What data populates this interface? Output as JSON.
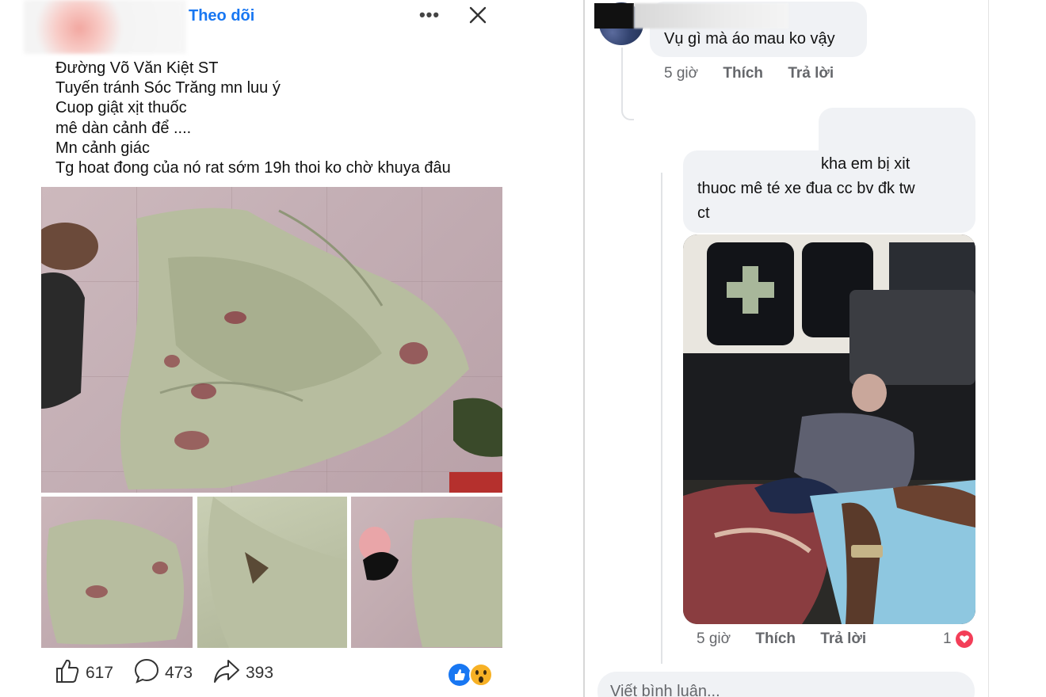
{
  "post": {
    "follow_label": "Theo dõi",
    "more_label": "•••",
    "lines": [
      "Đường Võ Văn Kiệt ST",
      "Tuyến tránh Sóc Trăng mn luu ý",
      "Cuop giật xịt thuốc",
      "mê dàn cảnh để ....",
      "Mn cảnh giác",
      "Tg hoat đong của nó rat sớm 19h thoi ko chờ khuya đâu"
    ],
    "stats": {
      "likes": "617",
      "comments": "473",
      "shares": "393"
    },
    "reaction_icons": [
      "like-icon",
      "wow-icon"
    ]
  },
  "comments": [
    {
      "text": "Vụ gì mà áo mau ko vậy",
      "time": "5 giờ",
      "like_label": "Thích",
      "reply_label": "Trả lời"
    },
    {
      "text_lines": [
        "kha em bị xit",
        "thuoc mê té xe đua cc bv đk tw",
        "ct"
      ],
      "time": "5 giờ",
      "like_label": "Thích",
      "reply_label": "Trả lời",
      "reaction_count": "1",
      "reaction_icon": "heart-icon"
    }
  ],
  "composer": {
    "placeholder": "Viết bình luận..."
  },
  "colors": {
    "accent": "#1877f2",
    "bubble": "#f0f2f5",
    "meta_text": "#65676b",
    "heart": "#f33e58"
  }
}
